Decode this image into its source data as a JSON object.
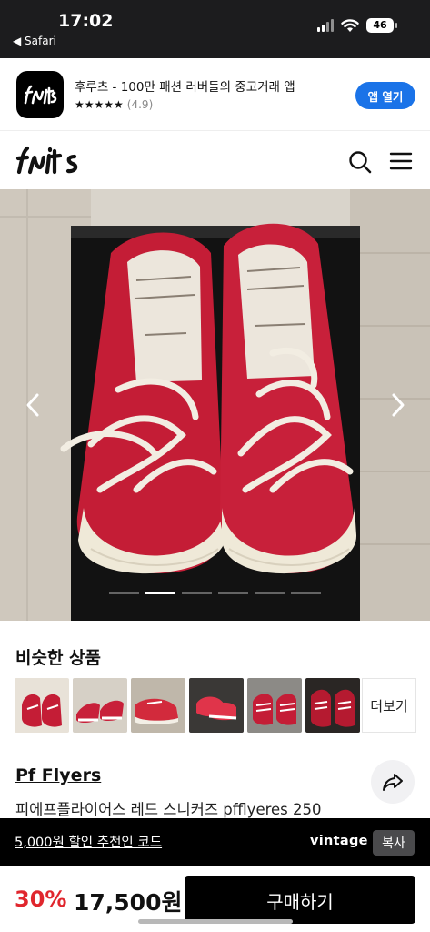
{
  "status_bar": {
    "time": "17:02",
    "back_label": "◀ Safari",
    "battery": "46",
    "icons": [
      "signal-icon",
      "wifi-icon",
      "battery-icon"
    ]
  },
  "app_banner": {
    "title": "후루츠 - 100만 패션 러버들의 중고거래 앱",
    "stars": "★★★★★",
    "rating": "(4.9)",
    "open_button": "앱 열기",
    "button_color": "#1a73e8"
  },
  "header": {
    "logo_text": "fruits",
    "icons": [
      "search-icon",
      "menu-icon"
    ]
  },
  "carousel": {
    "slide_count": 6,
    "active_index": 1,
    "icons": [
      "chevron-left-icon",
      "chevron-right-icon"
    ]
  },
  "similar": {
    "title": "비슷한 상품",
    "more_label": "더보기",
    "thumbnail_count": 6
  },
  "product": {
    "brand": "Pf Flyers",
    "name": "피에프플라이어스 레드 스니커즈 pfflyeres 250"
  },
  "promo": {
    "link_text": "5,000원 할인 추천인 코드",
    "brand": "vintage",
    "copy_label": "복사"
  },
  "purchase": {
    "discount": "30%",
    "price": "17,500원",
    "buy_label": "구매하기",
    "discount_color": "#e0262d"
  }
}
